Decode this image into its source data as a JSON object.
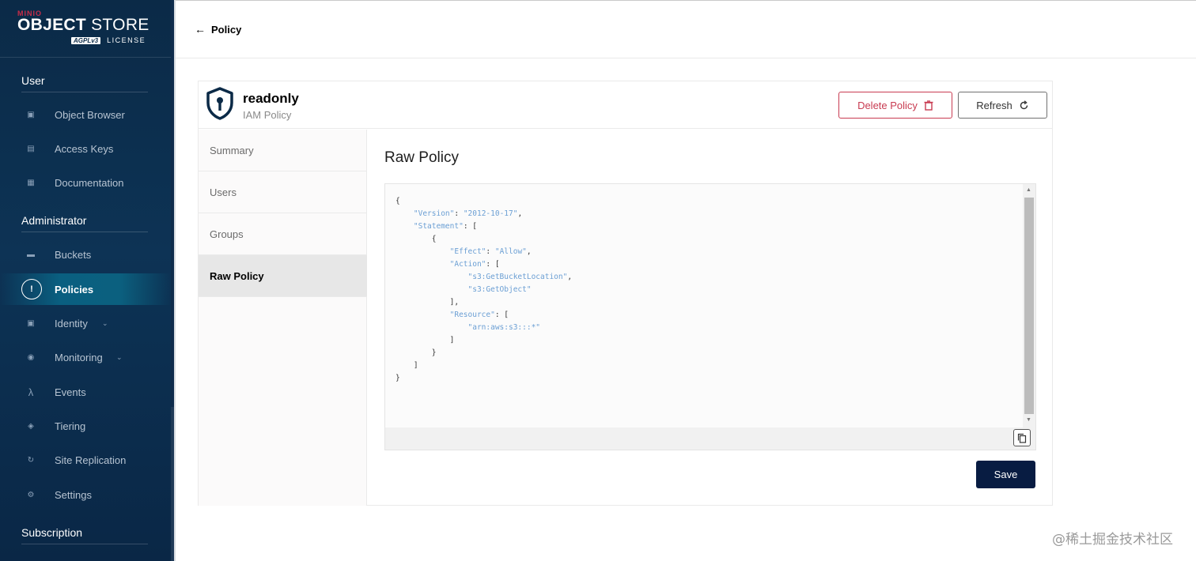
{
  "logo": {
    "brand": "MINIO",
    "product_bold": "OBJECT",
    "product_thin": "STORE",
    "license_badge": "AGPLv3",
    "license_label": "LICENSE"
  },
  "sidebar": {
    "sections": [
      {
        "title": "User"
      },
      {
        "title": "Administrator"
      },
      {
        "title": "Subscription"
      }
    ],
    "items": [
      {
        "label": "Object Browser",
        "icon": "object-browser-icon"
      },
      {
        "label": "Access Keys",
        "icon": "key-icon"
      },
      {
        "label": "Documentation",
        "icon": "document-icon"
      },
      {
        "label": "Buckets",
        "icon": "bucket-icon"
      },
      {
        "label": "Policies",
        "icon": "policy-icon",
        "active": true
      },
      {
        "label": "Identity",
        "icon": "identity-icon",
        "expandable": true
      },
      {
        "label": "Monitoring",
        "icon": "monitoring-icon",
        "expandable": true
      },
      {
        "label": "Events",
        "icon": "lambda-icon"
      },
      {
        "label": "Tiering",
        "icon": "tiering-icon"
      },
      {
        "label": "Site Replication",
        "icon": "replication-icon"
      },
      {
        "label": "Settings",
        "icon": "gear-icon"
      }
    ]
  },
  "header": {
    "back_label": "Policy"
  },
  "policy": {
    "name": "readonly",
    "type": "IAM Policy",
    "delete_label": "Delete Policy",
    "refresh_label": "Refresh"
  },
  "tabs": [
    {
      "label": "Summary"
    },
    {
      "label": "Users"
    },
    {
      "label": "Groups"
    },
    {
      "label": "Raw Policy",
      "active": true
    }
  ],
  "content": {
    "title": "Raw Policy",
    "raw_policy": {
      "Version": "2012-10-17",
      "Statement": [
        {
          "Effect": "Allow",
          "Action": [
            "s3:GetBucketLocation",
            "s3:GetObject"
          ],
          "Resource": [
            "arn:aws:s3:::*"
          ]
        }
      ]
    },
    "save_label": "Save"
  },
  "watermark": "@稀土掘金技术社区",
  "colors": {
    "sidebar": "#0b2a47",
    "active": "#0b607f",
    "danger": "#c83b51",
    "primary": "#081c42",
    "json_key": "#6b9fd4"
  }
}
